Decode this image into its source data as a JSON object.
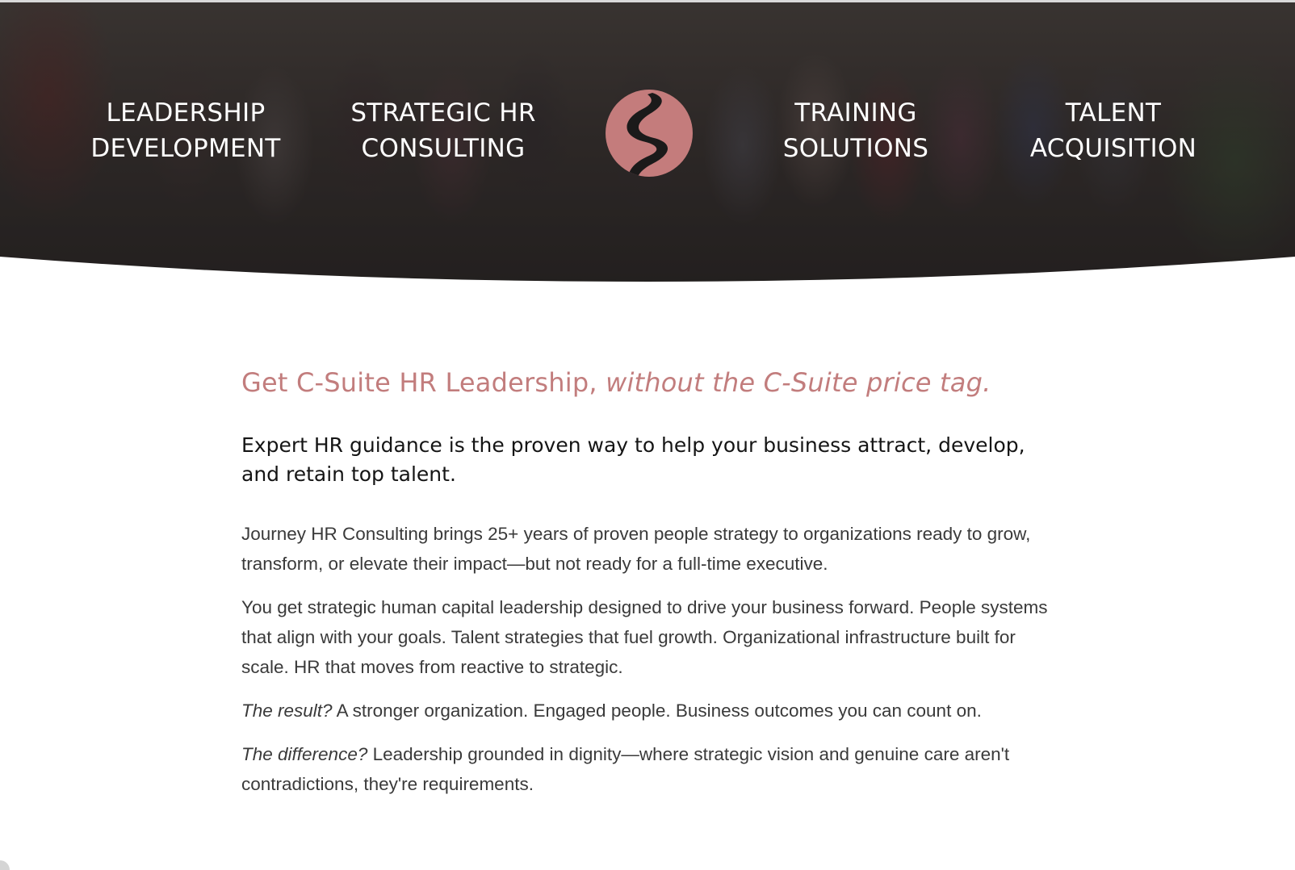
{
  "nav": {
    "items": [
      {
        "line1": "LEADERSHIP",
        "line2": "DEVELOPMENT"
      },
      {
        "line1": "STRATEGIC HR",
        "line2": "CONSULTING"
      },
      {
        "line1": "TRAINING",
        "line2": "SOLUTIONS"
      },
      {
        "line1": "TALENT",
        "line2": "ACQUISITION"
      }
    ],
    "logo_icon": "winding-road-logo-icon"
  },
  "colors": {
    "accent": "#c27d7d",
    "logo_bg": "#c47c7c",
    "heading_dark": "#151515",
    "body_text": "#3a3a3a"
  },
  "main": {
    "headline_main": "Get C-Suite HR Leadership,",
    "headline_italic": "without the C-Suite price tag.",
    "subhead": "Expert HR guidance is the proven way to help your business attract, develop, and retain top talent.",
    "para1": "Journey HR Consulting brings 25+ years of proven people strategy to organizations ready to grow, transform, or elevate their impact—but not ready for a full-time executive.",
    "para2": "You get strategic human capital leadership designed to drive your business forward. People systems that align with your goals. Talent strategies that fuel growth. Organizational infrastructure built for scale. HR that moves from reactive to strategic.",
    "para3_lead": "The result?",
    "para3_rest": "A stronger organization. Engaged people. Business outcomes you can count on.",
    "para4_lead": "The difference?",
    "para4_rest": "Leadership grounded in dignity—where strategic vision and genuine care aren't contradictions, they're requirements."
  }
}
